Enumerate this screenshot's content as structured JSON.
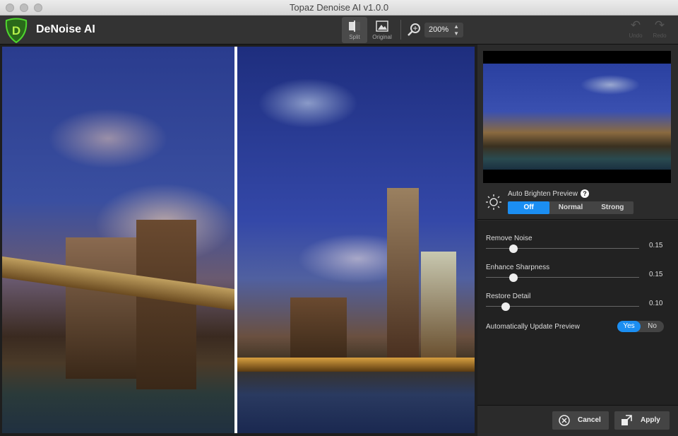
{
  "window": {
    "title": "Topaz Denoise AI v1.0.0"
  },
  "toolbar": {
    "app_name": "DeNoise AI",
    "split_label": "Split",
    "original_label": "Original",
    "zoom_value": "200%",
    "undo_label": "Undo",
    "redo_label": "Redo"
  },
  "panel": {
    "auto_brighten": {
      "label": "Auto Brighten Preview",
      "help": "?",
      "options": [
        "Off",
        "Normal",
        "Strong"
      ],
      "selected": "Off"
    },
    "sliders": [
      {
        "label": "Remove Noise",
        "value": "0.15",
        "fraction": 0.18
      },
      {
        "label": "Enhance Sharpness",
        "value": "0.15",
        "fraction": 0.18
      },
      {
        "label": "Restore Detail",
        "value": "0.10",
        "fraction": 0.13
      }
    ],
    "auto_update": {
      "label": "Automatically Update Preview",
      "yes": "Yes",
      "no": "No",
      "selected": "Yes"
    },
    "cancel_label": "Cancel",
    "apply_label": "Apply"
  },
  "colors": {
    "accent": "#1b8ef2",
    "logo": "#3fbf2a"
  }
}
